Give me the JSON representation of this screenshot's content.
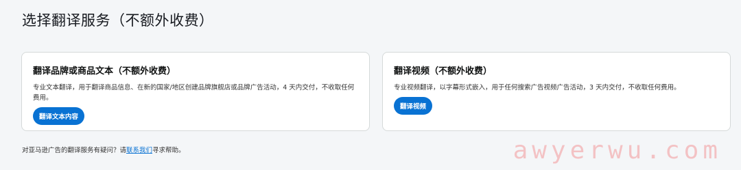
{
  "page": {
    "title": "选择翻译服务（不额外收费）"
  },
  "cards": [
    {
      "title": "翻译品牌或商品文本（不额外收费）",
      "description": "专业文本翻译，用于翻译商品信息、在新的国家/地区创建品牌旗舰店或品牌广告活动，4 天内交付，不收取任何费用。",
      "button_label": "翻译文本内容"
    },
    {
      "title": "翻译视频（不额外收费）",
      "description": "专业视频翻译，以字幕形式嵌入，用于任何搜索广告视频广告活动，3 天内交付，不收取任何费用。",
      "button_label": "翻译视频"
    }
  ],
  "footer": {
    "prefix": "对亚马逊广告的翻译服务有疑问？请",
    "link_label": "联系我们",
    "suffix": "寻求帮助。"
  },
  "watermark": "awyerwu.com",
  "colors": {
    "accent": "#0972d3",
    "background": "#f4f6f8",
    "watermark": "#f3b6b8"
  }
}
